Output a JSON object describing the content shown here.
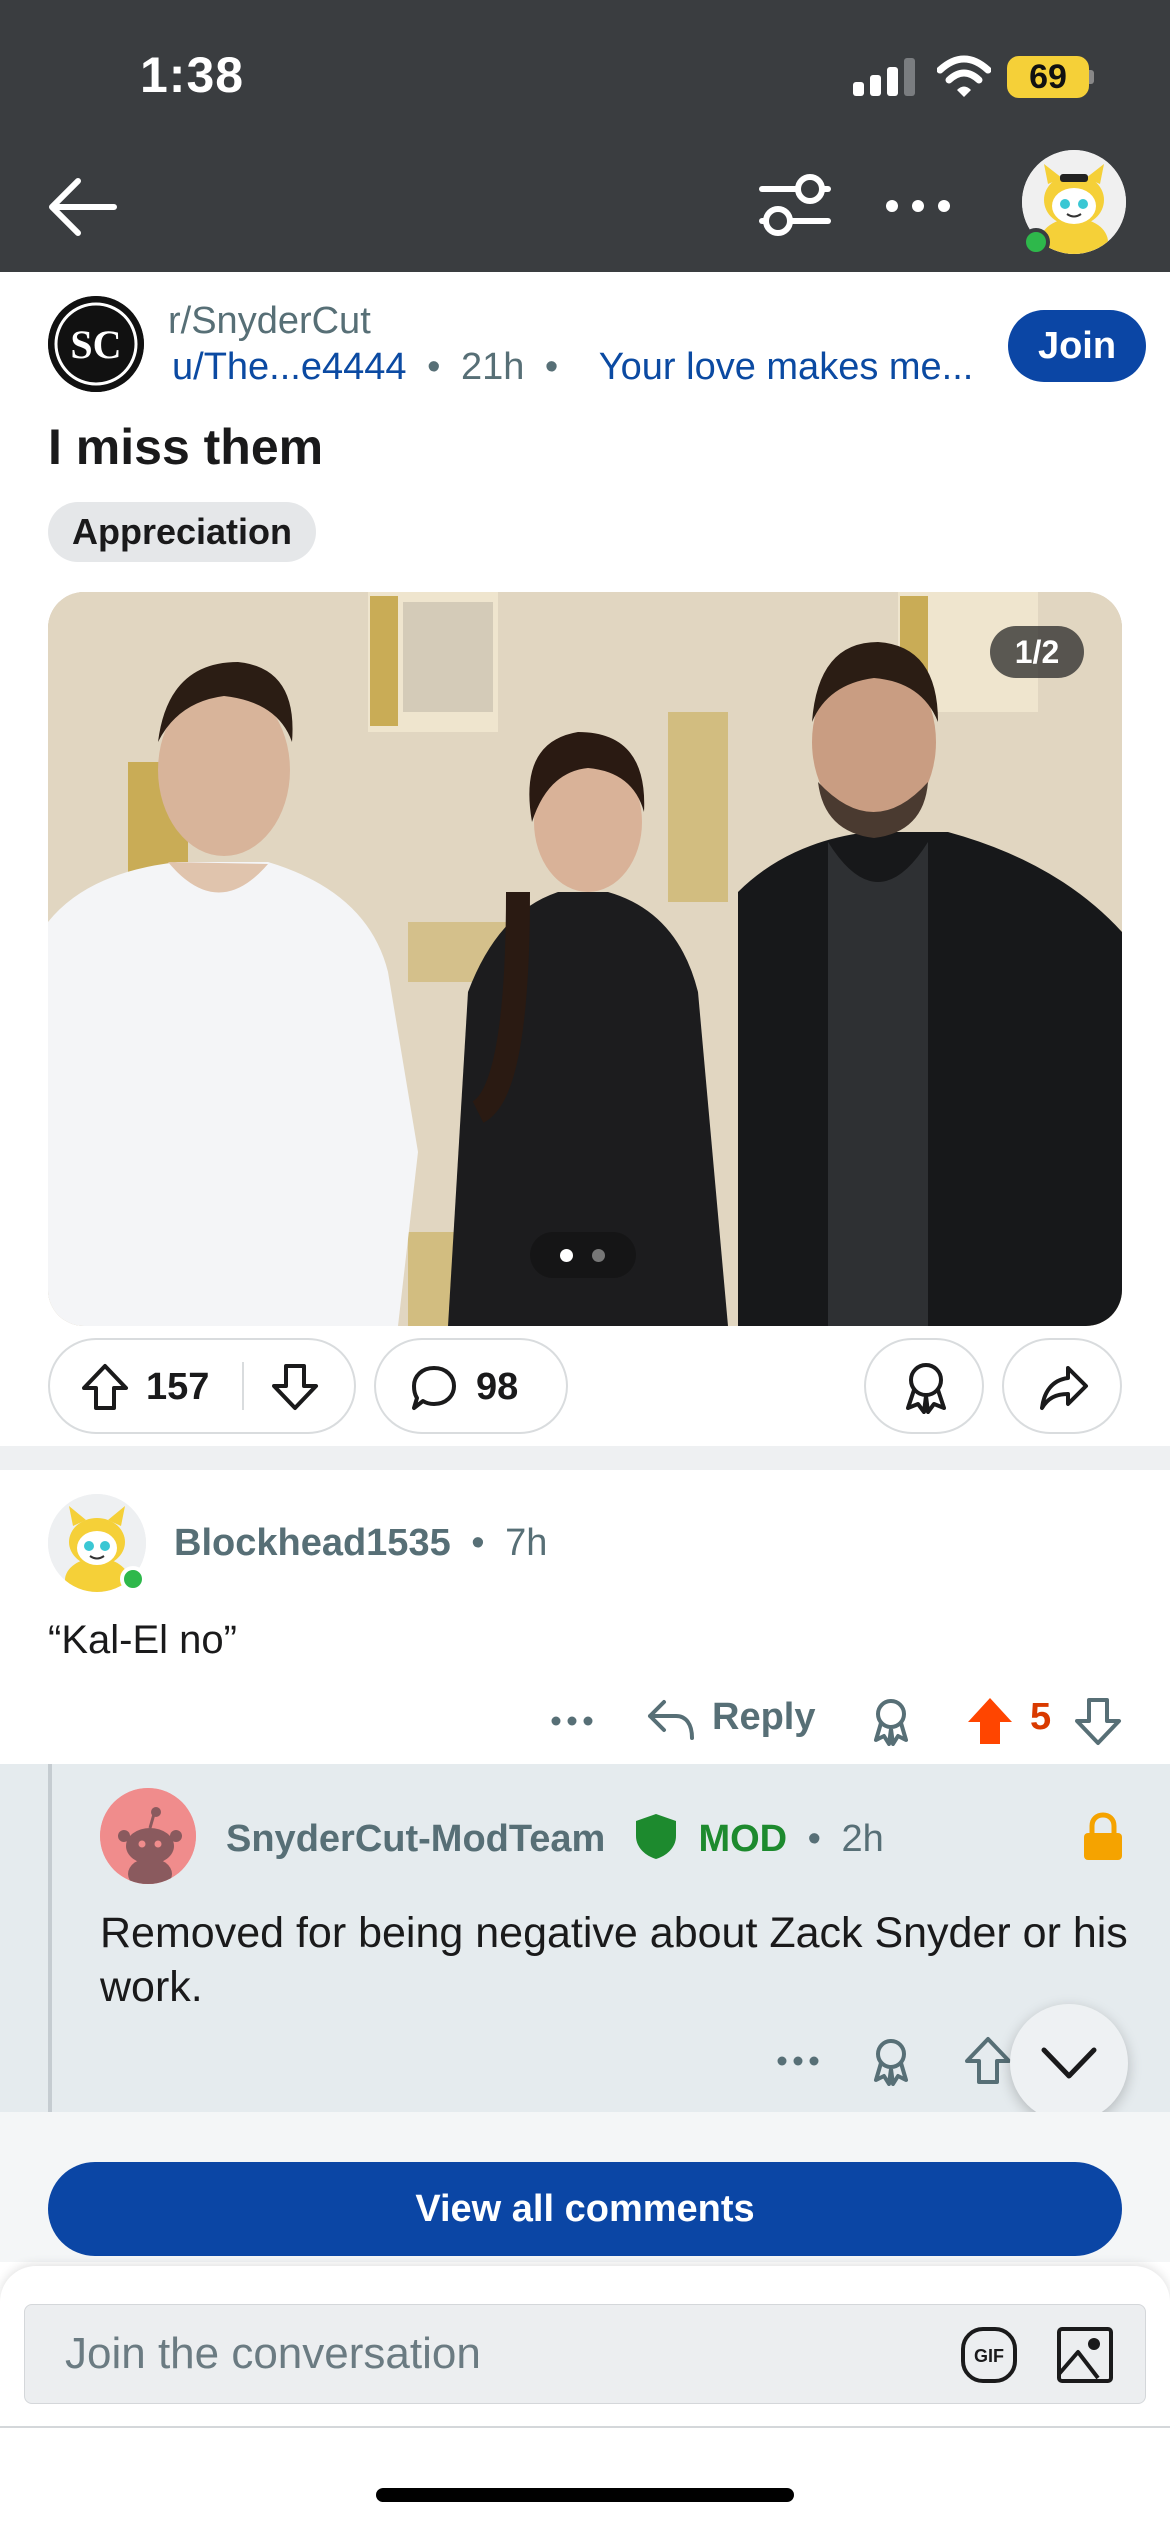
{
  "status_bar": {
    "time": "1:38",
    "battery": "69",
    "battery_color": "#f5d038"
  },
  "nav": {
    "back_icon": "arrow-left-icon",
    "filter_icon": "sliders-icon",
    "more_icon": "more-horizontal-icon",
    "avatar_icon": "user-avatar-icon"
  },
  "post": {
    "subreddit": "r/SnyderCut",
    "subreddit_icon_text": "SC",
    "author": "u/The...e4444",
    "age": "21h",
    "separator": "•",
    "user_flair": "Your love makes me...",
    "join_label": "Join",
    "title": "I miss them",
    "post_flair": "Appreciation",
    "image_counter": "1/2",
    "image_count": 2,
    "image_index": 1,
    "upvotes": "157",
    "comments": "98"
  },
  "comments": [
    {
      "author": "Blockhead1535",
      "age": "7h",
      "body": "“Kal-El no”",
      "reply_label": "Reply",
      "score": "5",
      "vote_state": "upvoted",
      "vote_color": "#ff4500"
    },
    {
      "author": "SnyderCut-ModTeam",
      "badge": "MOD",
      "age": "2h",
      "body": "Removed for being negative about Zack Snyder or his work.",
      "locked": true
    }
  ],
  "view_all_label": "View all comments",
  "composer": {
    "placeholder": "Join the conversation",
    "gif_label": "GIF"
  },
  "colors": {
    "accent_blue": "#0b46a5",
    "upvote_orange": "#ff4500",
    "mod_green": "#1d8a2e",
    "lock_orange": "#f5a300"
  }
}
